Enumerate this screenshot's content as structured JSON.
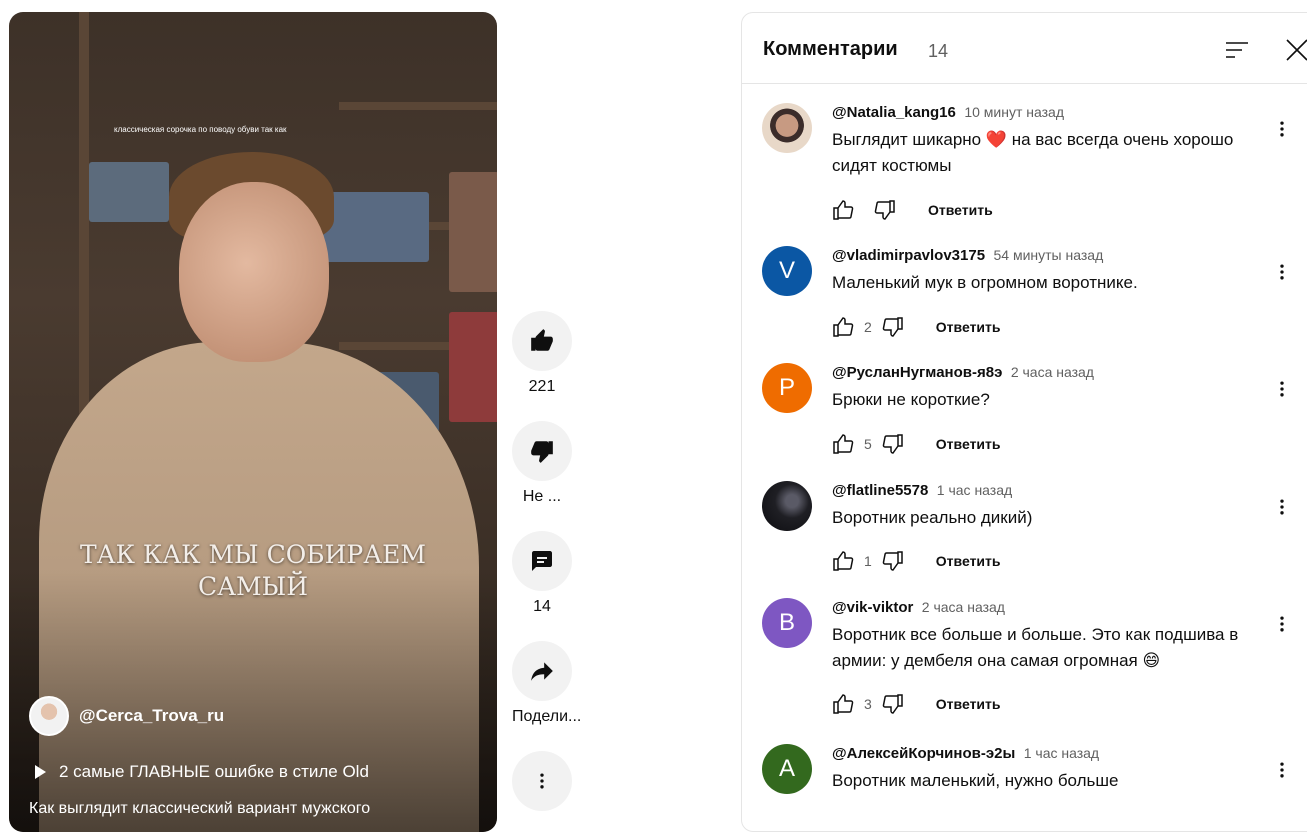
{
  "video": {
    "overlay_caption": "классическая сорочка по поводу обуви так как",
    "overlay_main": "ТАК КАК МЫ СОБИРАЕМ САМЫЙ",
    "channel": "@Cerca_Trova_ru",
    "playlist": "2 самые ГЛАВНЫЕ ошибке в стиле Old",
    "description": "Как выглядит классический вариант мужского"
  },
  "actions": {
    "like_count": "221",
    "dislike_label": "Не ...",
    "comments_count": "14",
    "share_label": "Подели..."
  },
  "comments_panel": {
    "title": "Комментарии",
    "count": "14",
    "reply_label": "Ответить",
    "items": [
      {
        "author": "@Natalia_kang16",
        "time": "10 минут назад",
        "text": "Выглядит шикарно ❤️ на вас всегда очень хорошо сидят костюмы",
        "likes": "",
        "avatar_letter": "",
        "avatar_color": "#d9c6b5"
      },
      {
        "author": "@vladimirpavlov3175",
        "time": "54 минуты назад",
        "text": "Маленький мук в огромном воротнике.",
        "likes": "2",
        "avatar_letter": "V",
        "avatar_color": "#0b57a4"
      },
      {
        "author": "@РусланНугманов-я8э",
        "time": "2 часа назад",
        "text": "Брюки не короткие?",
        "likes": "5",
        "avatar_letter": "Р",
        "avatar_color": "#ef6c00"
      },
      {
        "author": "@flatline5578",
        "time": "1 час назад",
        "text": "Воротник реально дикий)",
        "likes": "1",
        "avatar_letter": "",
        "avatar_color": "#1f1f24"
      },
      {
        "author": "@vik-viktor",
        "time": "2 часа назад",
        "text": "Воротник все больше и больше. Это как подшива в армии: у дембеля она самая огромная 😄",
        "likes": "3",
        "avatar_letter": "В",
        "avatar_color": "#7e57c2"
      },
      {
        "author": "@АлексейКорчинов-э2ы",
        "time": "1 час назад",
        "text": "Воротник маленький, нужно больше",
        "likes": "",
        "avatar_letter": "А",
        "avatar_color": "#33691e"
      }
    ]
  }
}
